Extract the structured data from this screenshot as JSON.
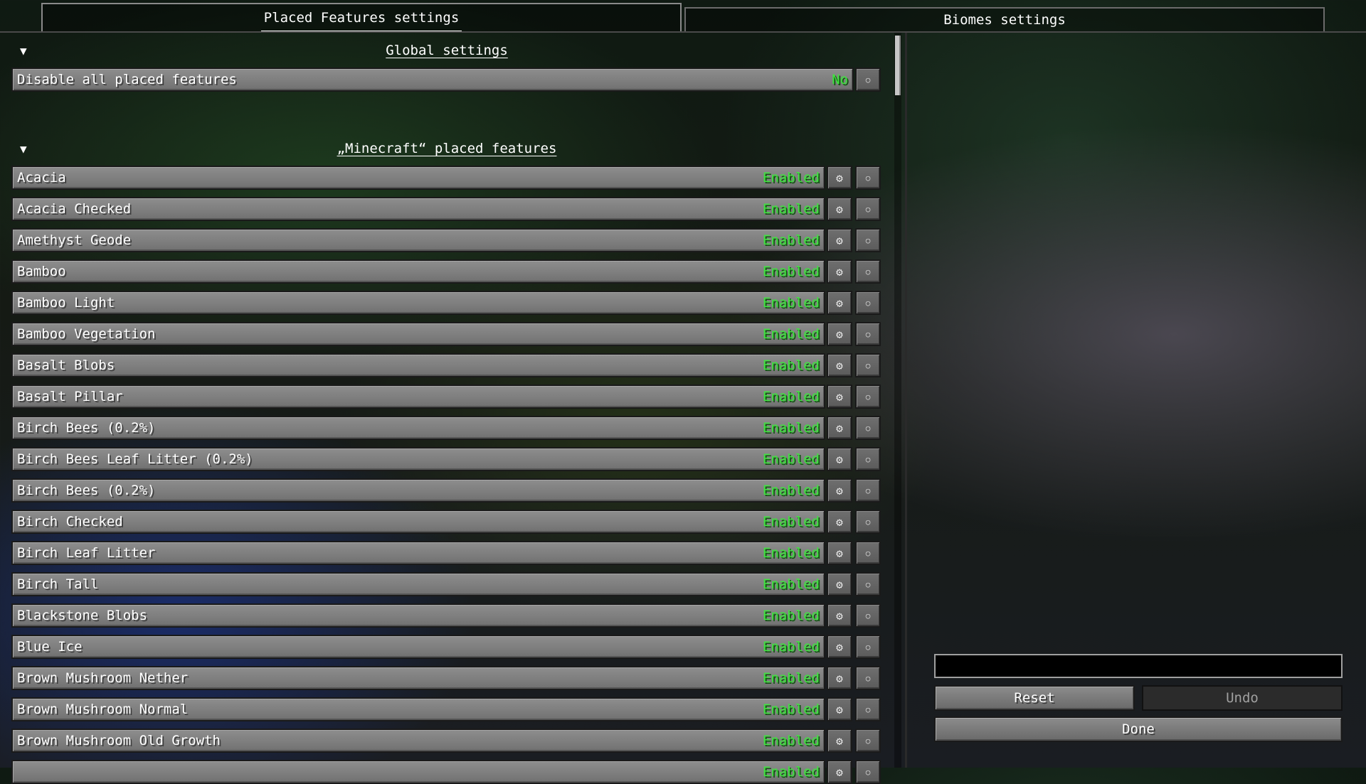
{
  "tabs": [
    {
      "label": "Placed Features settings",
      "active": true
    },
    {
      "label": "Biomes settings",
      "active": false
    }
  ],
  "global": {
    "title": "Global settings",
    "collapse_glyph": "▼",
    "rows": [
      {
        "name": "Disable all placed features",
        "value": "No"
      }
    ]
  },
  "features": {
    "title": "„Minecraft“ placed features",
    "collapse_glyph": "▼",
    "status_color": "#3fe33f",
    "rows": [
      {
        "name": "Acacia",
        "status": "Enabled"
      },
      {
        "name": "Acacia Checked",
        "status": "Enabled"
      },
      {
        "name": "Amethyst Geode",
        "status": "Enabled"
      },
      {
        "name": "Bamboo",
        "status": "Enabled"
      },
      {
        "name": "Bamboo Light",
        "status": "Enabled"
      },
      {
        "name": "Bamboo Vegetation",
        "status": "Enabled"
      },
      {
        "name": "Basalt Blobs",
        "status": "Enabled"
      },
      {
        "name": "Basalt Pillar",
        "status": "Enabled"
      },
      {
        "name": "Birch Bees (0.2%)",
        "status": "Enabled"
      },
      {
        "name": "Birch Bees Leaf Litter (0.2%)",
        "status": "Enabled"
      },
      {
        "name": "Birch Bees (0.2%)",
        "status": "Enabled"
      },
      {
        "name": "Birch Checked",
        "status": "Enabled"
      },
      {
        "name": "Birch Leaf Litter",
        "status": "Enabled"
      },
      {
        "name": "Birch Tall",
        "status": "Enabled"
      },
      {
        "name": "Blackstone Blobs",
        "status": "Enabled"
      },
      {
        "name": "Blue Ice",
        "status": "Enabled"
      },
      {
        "name": "Brown Mushroom Nether",
        "status": "Enabled"
      },
      {
        "name": "Brown Mushroom Normal",
        "status": "Enabled"
      },
      {
        "name": "Brown Mushroom Old Growth",
        "status": "Enabled"
      },
      {
        "name": "",
        "status": "Enabled"
      }
    ]
  },
  "icons": {
    "gear": "gear-icon",
    "reset": "reset-icon"
  },
  "search": {
    "value": "",
    "placeholder": ""
  },
  "buttons": {
    "reset": "Reset",
    "undo": "Undo",
    "done": "Done"
  }
}
